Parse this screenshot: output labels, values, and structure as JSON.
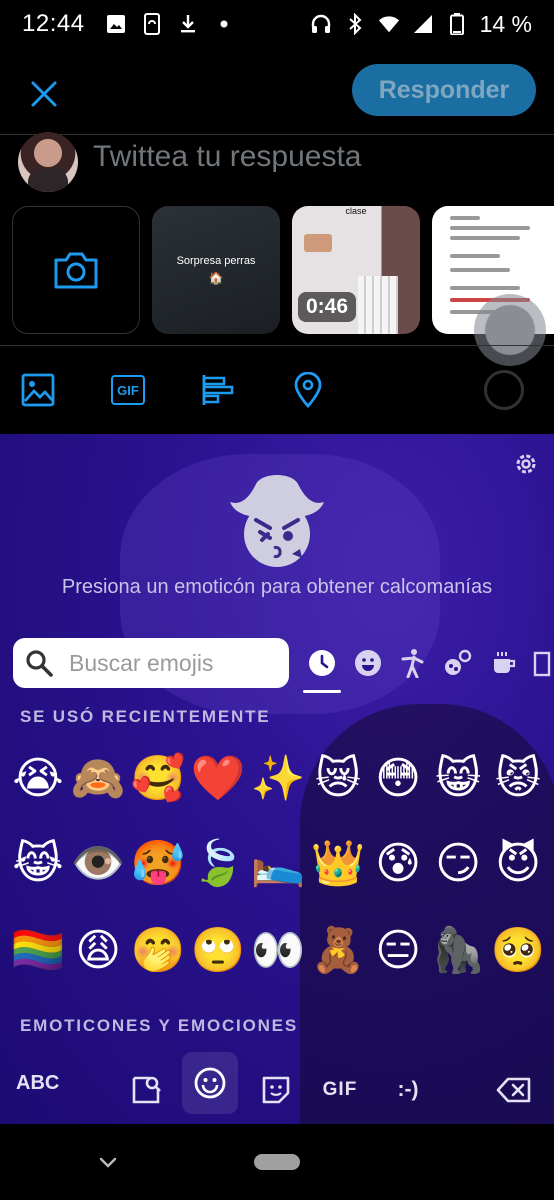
{
  "status_bar": {
    "time": "12:44",
    "battery": "14 %"
  },
  "compose": {
    "reply_button": "Responder",
    "reply_placeholder": "Twittea tu respuesta"
  },
  "media": {
    "tile_1_text": "Sorpresa perras",
    "tile_2_caption": "clase",
    "tile_2_duration": "0:46"
  },
  "keyboard": {
    "sticker_hint": "Presiona un emoticón para obtener calcomanías",
    "search_placeholder": "Buscar emojis",
    "recent_label": "SE USÓ RECIENTEMENTE",
    "emotions_label": "EMOTICONES Y EMOCIONES",
    "abc_label": "ABC",
    "gif_label": "GIF",
    "emoticon_label": ":-)",
    "recent_emojis": [
      [
        "😭",
        "🙈",
        "🥰",
        "❤️",
        "✨",
        "😿",
        "😳",
        "😸",
        "😾"
      ],
      [
        "😹",
        "👁️",
        "🥵",
        "🍃",
        "🛌",
        "👑",
        "😰",
        "😏",
        "😈"
      ],
      [
        "🏳️‍🌈",
        "😩",
        "🤭",
        "🙄",
        "👀",
        "🧸",
        "😑",
        "🦍",
        "🥺"
      ]
    ]
  },
  "colors": {
    "accent": "#1d9bf0",
    "reply_button_bg": "#1a6ea1",
    "keyboard_bg": "#2a1290"
  }
}
